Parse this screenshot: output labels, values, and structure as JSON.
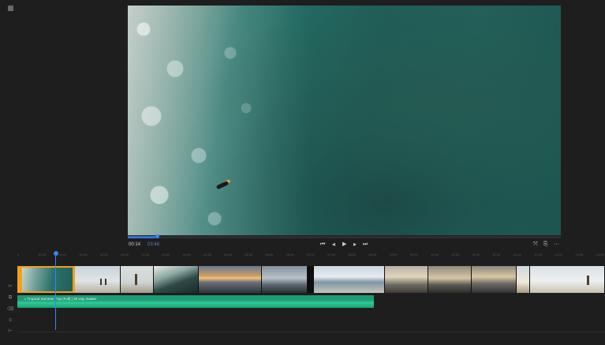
{
  "monitor": {
    "timecode_current": "00:14",
    "timecode_total": "03:48",
    "playhead_fraction": 0.064
  },
  "transport": {
    "go_to_start_icon": "⏮",
    "step_back_icon": "◀",
    "play_icon": "▶",
    "step_forward_icon": "▶",
    "go_to_end_icon": "⏭"
  },
  "right_controls": {
    "fit_icon": "⤧",
    "export_icon": "⎘",
    "more_icon": "···"
  },
  "ruler": {
    "ticks": [
      "0",
      "00:30",
      "01:00",
      "01:30",
      "02:00",
      "02:30",
      "03:00",
      "03:30",
      "04:00",
      "04:30",
      "05:00",
      "05:30",
      "06:00",
      "06:30",
      "07:00",
      "07:30",
      "08:00",
      "08:30",
      "09:00",
      "09:30",
      "10:00",
      "10:30",
      "11:00",
      "11:30",
      "12:00",
      "12:30",
      "13:00",
      "13:30",
      "14:00"
    ]
  },
  "audio": {
    "clip_label": "♫  Tropical Summer Pop (Full) [ 30 way master"
  },
  "colors": {
    "accent": "#3b82f6",
    "audio": "#1f9b76",
    "selected_clip_border": "#f0a020"
  }
}
